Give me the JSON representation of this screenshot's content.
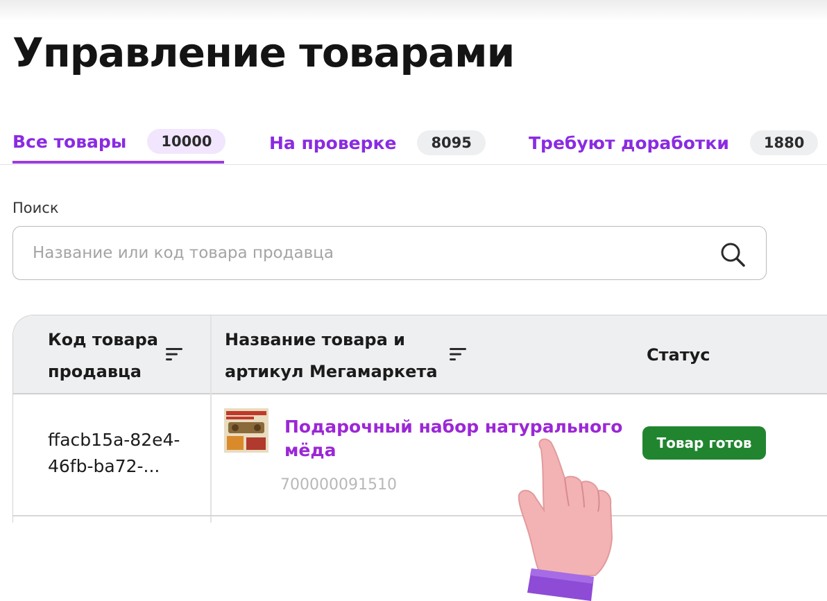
{
  "page": {
    "title": "Управление товарами"
  },
  "tabs": [
    {
      "label": "Все товары",
      "count": "10000",
      "active": true
    },
    {
      "label": "На проверке",
      "count": "8095",
      "active": false
    },
    {
      "label": "Требуют доработки",
      "count": "1880",
      "active": false
    }
  ],
  "search": {
    "label": "Поиск",
    "placeholder": "Название или код товара продавца",
    "icon": "search-icon"
  },
  "table": {
    "columns": {
      "code": "Код товара продавца",
      "name": "Название товара и артикул Мегамаркета",
      "status": "Статус"
    },
    "rows": [
      {
        "code": "ffacb15a-82e4-46fb-ba72-...",
        "name": "Подарочный набор натурального мёда",
        "sku": "700000091510",
        "status": "Товар готов",
        "status_color": "#218530"
      }
    ]
  },
  "colors": {
    "accent": "#8a2be2",
    "status_ready": "#218530"
  }
}
